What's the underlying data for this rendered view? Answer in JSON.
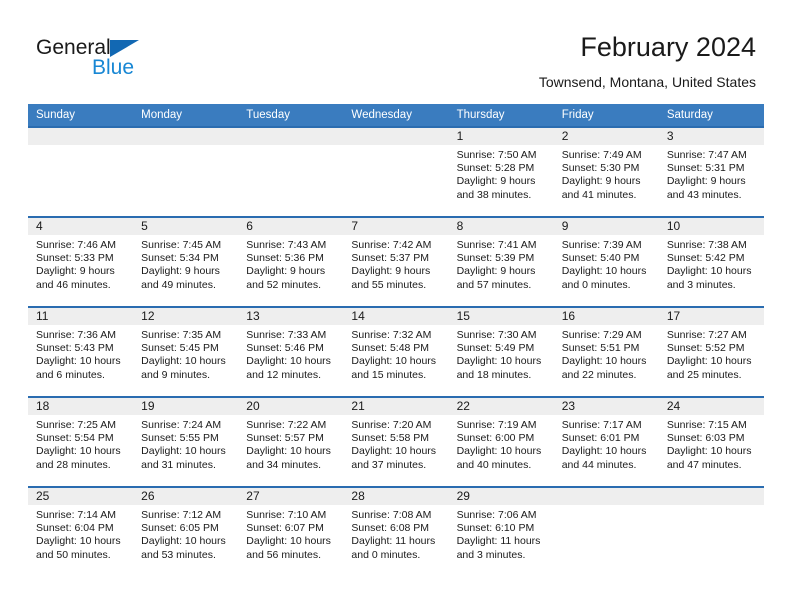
{
  "brand": {
    "name_top": "General",
    "name_bottom": "Blue",
    "triangle_color": "#1268b3",
    "blue_text_color": "#1887d4"
  },
  "header": {
    "title": "February 2024",
    "subtitle": "Townsend, Montana, United States"
  },
  "theme": {
    "header_bg": "#3a7cbf",
    "row_border": "#2a6cb0",
    "daynum_band_bg": "#eeeeee",
    "text": "#1a1a1a"
  },
  "weekday_headers": [
    "Sunday",
    "Monday",
    "Tuesday",
    "Wednesday",
    "Thursday",
    "Friday",
    "Saturday"
  ],
  "weeks": [
    [
      {
        "day": "",
        "blank": true
      },
      {
        "day": "",
        "blank": true
      },
      {
        "day": "",
        "blank": true
      },
      {
        "day": "",
        "blank": true
      },
      {
        "day": "1",
        "sunrise": "Sunrise: 7:50 AM",
        "sunset": "Sunset: 5:28 PM",
        "daylight": "Daylight: 9 hours and 38 minutes."
      },
      {
        "day": "2",
        "sunrise": "Sunrise: 7:49 AM",
        "sunset": "Sunset: 5:30 PM",
        "daylight": "Daylight: 9 hours and 41 minutes."
      },
      {
        "day": "3",
        "sunrise": "Sunrise: 7:47 AM",
        "sunset": "Sunset: 5:31 PM",
        "daylight": "Daylight: 9 hours and 43 minutes."
      }
    ],
    [
      {
        "day": "4",
        "sunrise": "Sunrise: 7:46 AM",
        "sunset": "Sunset: 5:33 PM",
        "daylight": "Daylight: 9 hours and 46 minutes."
      },
      {
        "day": "5",
        "sunrise": "Sunrise: 7:45 AM",
        "sunset": "Sunset: 5:34 PM",
        "daylight": "Daylight: 9 hours and 49 minutes."
      },
      {
        "day": "6",
        "sunrise": "Sunrise: 7:43 AM",
        "sunset": "Sunset: 5:36 PM",
        "daylight": "Daylight: 9 hours and 52 minutes."
      },
      {
        "day": "7",
        "sunrise": "Sunrise: 7:42 AM",
        "sunset": "Sunset: 5:37 PM",
        "daylight": "Daylight: 9 hours and 55 minutes."
      },
      {
        "day": "8",
        "sunrise": "Sunrise: 7:41 AM",
        "sunset": "Sunset: 5:39 PM",
        "daylight": "Daylight: 9 hours and 57 minutes."
      },
      {
        "day": "9",
        "sunrise": "Sunrise: 7:39 AM",
        "sunset": "Sunset: 5:40 PM",
        "daylight": "Daylight: 10 hours and 0 minutes."
      },
      {
        "day": "10",
        "sunrise": "Sunrise: 7:38 AM",
        "sunset": "Sunset: 5:42 PM",
        "daylight": "Daylight: 10 hours and 3 minutes."
      }
    ],
    [
      {
        "day": "11",
        "sunrise": "Sunrise: 7:36 AM",
        "sunset": "Sunset: 5:43 PM",
        "daylight": "Daylight: 10 hours and 6 minutes."
      },
      {
        "day": "12",
        "sunrise": "Sunrise: 7:35 AM",
        "sunset": "Sunset: 5:45 PM",
        "daylight": "Daylight: 10 hours and 9 minutes."
      },
      {
        "day": "13",
        "sunrise": "Sunrise: 7:33 AM",
        "sunset": "Sunset: 5:46 PM",
        "daylight": "Daylight: 10 hours and 12 minutes."
      },
      {
        "day": "14",
        "sunrise": "Sunrise: 7:32 AM",
        "sunset": "Sunset: 5:48 PM",
        "daylight": "Daylight: 10 hours and 15 minutes."
      },
      {
        "day": "15",
        "sunrise": "Sunrise: 7:30 AM",
        "sunset": "Sunset: 5:49 PM",
        "daylight": "Daylight: 10 hours and 18 minutes."
      },
      {
        "day": "16",
        "sunrise": "Sunrise: 7:29 AM",
        "sunset": "Sunset: 5:51 PM",
        "daylight": "Daylight: 10 hours and 22 minutes."
      },
      {
        "day": "17",
        "sunrise": "Sunrise: 7:27 AM",
        "sunset": "Sunset: 5:52 PM",
        "daylight": "Daylight: 10 hours and 25 minutes."
      }
    ],
    [
      {
        "day": "18",
        "sunrise": "Sunrise: 7:25 AM",
        "sunset": "Sunset: 5:54 PM",
        "daylight": "Daylight: 10 hours and 28 minutes."
      },
      {
        "day": "19",
        "sunrise": "Sunrise: 7:24 AM",
        "sunset": "Sunset: 5:55 PM",
        "daylight": "Daylight: 10 hours and 31 minutes."
      },
      {
        "day": "20",
        "sunrise": "Sunrise: 7:22 AM",
        "sunset": "Sunset: 5:57 PM",
        "daylight": "Daylight: 10 hours and 34 minutes."
      },
      {
        "day": "21",
        "sunrise": "Sunrise: 7:20 AM",
        "sunset": "Sunset: 5:58 PM",
        "daylight": "Daylight: 10 hours and 37 minutes."
      },
      {
        "day": "22",
        "sunrise": "Sunrise: 7:19 AM",
        "sunset": "Sunset: 6:00 PM",
        "daylight": "Daylight: 10 hours and 40 minutes."
      },
      {
        "day": "23",
        "sunrise": "Sunrise: 7:17 AM",
        "sunset": "Sunset: 6:01 PM",
        "daylight": "Daylight: 10 hours and 44 minutes."
      },
      {
        "day": "24",
        "sunrise": "Sunrise: 7:15 AM",
        "sunset": "Sunset: 6:03 PM",
        "daylight": "Daylight: 10 hours and 47 minutes."
      }
    ],
    [
      {
        "day": "25",
        "sunrise": "Sunrise: 7:14 AM",
        "sunset": "Sunset: 6:04 PM",
        "daylight": "Daylight: 10 hours and 50 minutes."
      },
      {
        "day": "26",
        "sunrise": "Sunrise: 7:12 AM",
        "sunset": "Sunset: 6:05 PM",
        "daylight": "Daylight: 10 hours and 53 minutes."
      },
      {
        "day": "27",
        "sunrise": "Sunrise: 7:10 AM",
        "sunset": "Sunset: 6:07 PM",
        "daylight": "Daylight: 10 hours and 56 minutes."
      },
      {
        "day": "28",
        "sunrise": "Sunrise: 7:08 AM",
        "sunset": "Sunset: 6:08 PM",
        "daylight": "Daylight: 11 hours and 0 minutes."
      },
      {
        "day": "29",
        "sunrise": "Sunrise: 7:06 AM",
        "sunset": "Sunset: 6:10 PM",
        "daylight": "Daylight: 11 hours and 3 minutes."
      },
      {
        "day": "",
        "blank": true
      },
      {
        "day": "",
        "blank": true
      }
    ]
  ]
}
